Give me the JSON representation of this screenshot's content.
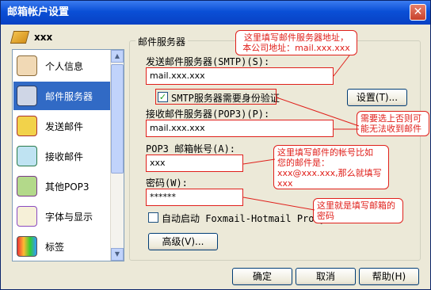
{
  "window": {
    "title": "邮箱帐户设置",
    "close_glyph": "✕"
  },
  "account": {
    "name": "xxx",
    "icon": "envelope-icon"
  },
  "sidebar": {
    "items": [
      {
        "label": "个人信息",
        "icon": "person-icon",
        "selected": false
      },
      {
        "label": "邮件服务器",
        "icon": "server-icon",
        "selected": true
      },
      {
        "label": "发送邮件",
        "icon": "send-mail-icon",
        "selected": false
      },
      {
        "label": "接收邮件",
        "icon": "receive-mail-icon",
        "selected": false
      },
      {
        "label": "其他POP3",
        "icon": "pop3-icon",
        "selected": false
      },
      {
        "label": "字体与显示",
        "icon": "font-icon",
        "selected": false
      },
      {
        "label": "标签",
        "icon": "tag-icon",
        "selected": false
      }
    ]
  },
  "group": {
    "title": "邮件服务器"
  },
  "form": {
    "smtp_label": "发送邮件服务器(SMTP)(S):",
    "smtp_value": "mail.xxx.xxx",
    "smtp_auth_label": "SMTP服务器需要身份验证",
    "smtp_auth_checked": true,
    "settings_button": "设置(T)...",
    "pop3_label": "接收邮件服务器(POP3)(P):",
    "pop3_value": "mail.xxx.xxx",
    "account_label": "POP3 邮箱帐号(A):",
    "account_value": "xxx",
    "password_label": "密码(W):",
    "password_value": "******",
    "autostart_label": "自动启动 Foxmail-Hotmail Proxy",
    "autostart_checked": false,
    "advanced_button": "高级(V)..."
  },
  "callouts": {
    "smtp": [
      "这里填写邮件服务器地址，",
      "本公司地址：mail.xxx.xxx"
    ],
    "auth": [
      "需要选上否则可",
      "能无法收到邮件"
    ],
    "account": [
      "这里填写邮件的帐号比如",
      "您的邮件是：",
      "xxx@xxx.xxx,那么就填写",
      "xxx"
    ],
    "password": [
      "这里就是填写邮箱的",
      "密码"
    ]
  },
  "footer": {
    "ok": "确定",
    "cancel": "取消",
    "help": "帮助(H)"
  },
  "colors": {
    "title_bar": "#0a4fd6",
    "selection": "#316ac5",
    "annotation": "#e0201b",
    "dialog_bg": "#ece9d8"
  }
}
